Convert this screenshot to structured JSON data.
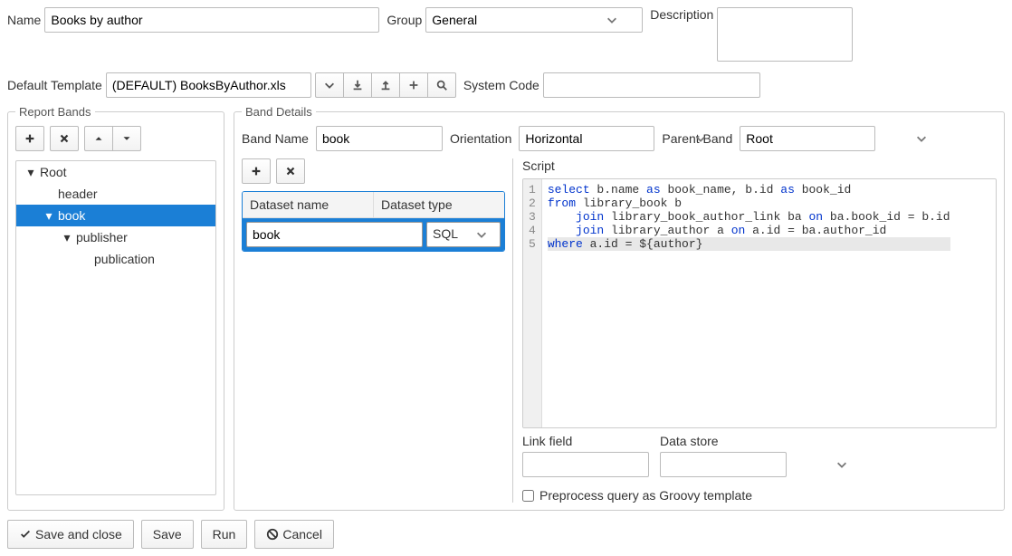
{
  "top": {
    "name_label": "Name",
    "name_value": "Books by author",
    "group_label": "Group",
    "group_value": "General",
    "description_label": "Description",
    "description_value": "",
    "template_label": "Default Template",
    "template_value": "(DEFAULT) BooksByAuthor.xls",
    "syscode_label": "System Code",
    "syscode_value": ""
  },
  "bands_panel": {
    "legend": "Report Bands",
    "tree": [
      {
        "label": "Root",
        "indent": 10,
        "expanded": true,
        "selected": false
      },
      {
        "label": "header",
        "indent": 30,
        "expanded": null,
        "selected": false
      },
      {
        "label": "book",
        "indent": 30,
        "expanded": true,
        "selected": true
      },
      {
        "label": "publisher",
        "indent": 50,
        "expanded": true,
        "selected": false
      },
      {
        "label": "publication",
        "indent": 70,
        "expanded": null,
        "selected": false
      }
    ]
  },
  "details": {
    "legend": "Band Details",
    "bandname_label": "Band Name",
    "bandname_value": "book",
    "orient_label": "Orientation",
    "orient_value": "Horizontal",
    "parent_label": "Parent Band",
    "parent_value": "Root",
    "ds_headers": {
      "name": "Dataset name",
      "type": "Dataset type"
    },
    "ds_row": {
      "name": "book",
      "type": "SQL"
    },
    "script_label": "Script",
    "script_lines": [
      {
        "num": "1",
        "segs": [
          {
            "t": "select",
            "k": true
          },
          {
            "t": " b.name "
          },
          {
            "t": "as",
            "k": true
          },
          {
            "t": " book_name, b.id "
          },
          {
            "t": "as",
            "k": true
          },
          {
            "t": " book_id"
          }
        ]
      },
      {
        "num": "2",
        "segs": [
          {
            "t": "from",
            "k": true
          },
          {
            "t": " library_book b"
          }
        ]
      },
      {
        "num": "3",
        "segs": [
          {
            "t": "    "
          },
          {
            "t": "join",
            "k": true
          },
          {
            "t": " library_book_author_link ba "
          },
          {
            "t": "on",
            "k": true
          },
          {
            "t": " ba.book_id = b.id"
          }
        ]
      },
      {
        "num": "4",
        "segs": [
          {
            "t": "    "
          },
          {
            "t": "join",
            "k": true
          },
          {
            "t": " library_author a "
          },
          {
            "t": "on",
            "k": true
          },
          {
            "t": " a.id = ba.author_id"
          }
        ]
      },
      {
        "num": "5",
        "hl": true,
        "segs": [
          {
            "t": "where",
            "k": true
          },
          {
            "t": " a.id = ${author}"
          }
        ]
      }
    ],
    "linkfield_label": "Link field",
    "linkfield_value": "",
    "datastore_label": "Data store",
    "datastore_value": "",
    "preprocess_label": "Preprocess query as Groovy template"
  },
  "footer": {
    "save_close": "Save and close",
    "save": "Save",
    "run": "Run",
    "cancel": "Cancel"
  }
}
